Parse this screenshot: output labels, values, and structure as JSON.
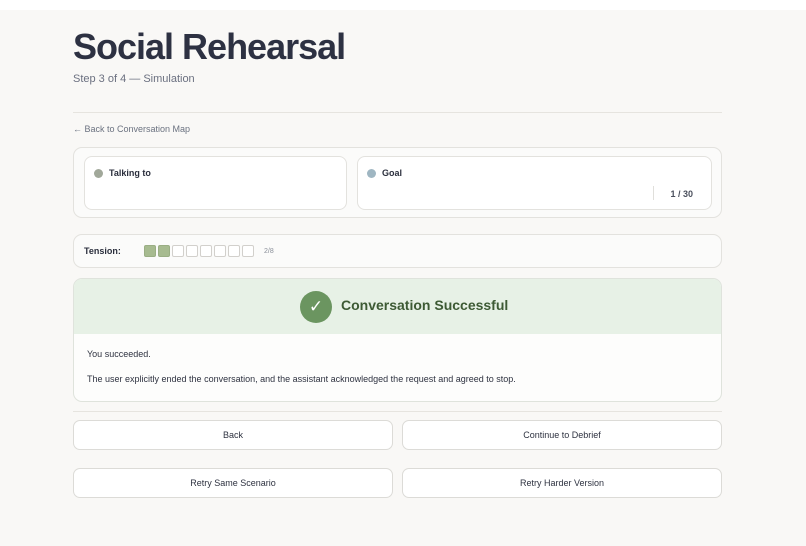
{
  "header": {
    "title": "Social Rehearsal",
    "subtitle": "Step 3 of 4 — Simulation"
  },
  "nav": {
    "back_link": "← Back to Conversation Map"
  },
  "info": {
    "talking_to_label": "Talking to",
    "goal_label": "Goal",
    "goal_counter": "1 / 30"
  },
  "tension": {
    "label": "Tension:",
    "level": 2,
    "max": 8,
    "count_text": "2/8"
  },
  "result": {
    "check_glyph": "✓",
    "title": "Conversation Successful",
    "line1": "You succeeded.",
    "line2": "The user explicitly ended the conversation, and the assistant acknowledged the request and agreed to stop."
  },
  "actions": {
    "back": "Back",
    "continue": "Continue to Debrief",
    "retry_same": "Retry Same Scenario",
    "retry_harder": "Retry Harder Version"
  },
  "colors": {
    "talking_dot": "#a1a89a",
    "goal_dot": "#9fb6c2",
    "tension_filled": "#a7bb90",
    "success_green": "#6b9560",
    "success_bg": "#e7f1e6"
  },
  "icons": {
    "check": "check-icon",
    "back_arrow": "arrow-left-icon"
  }
}
